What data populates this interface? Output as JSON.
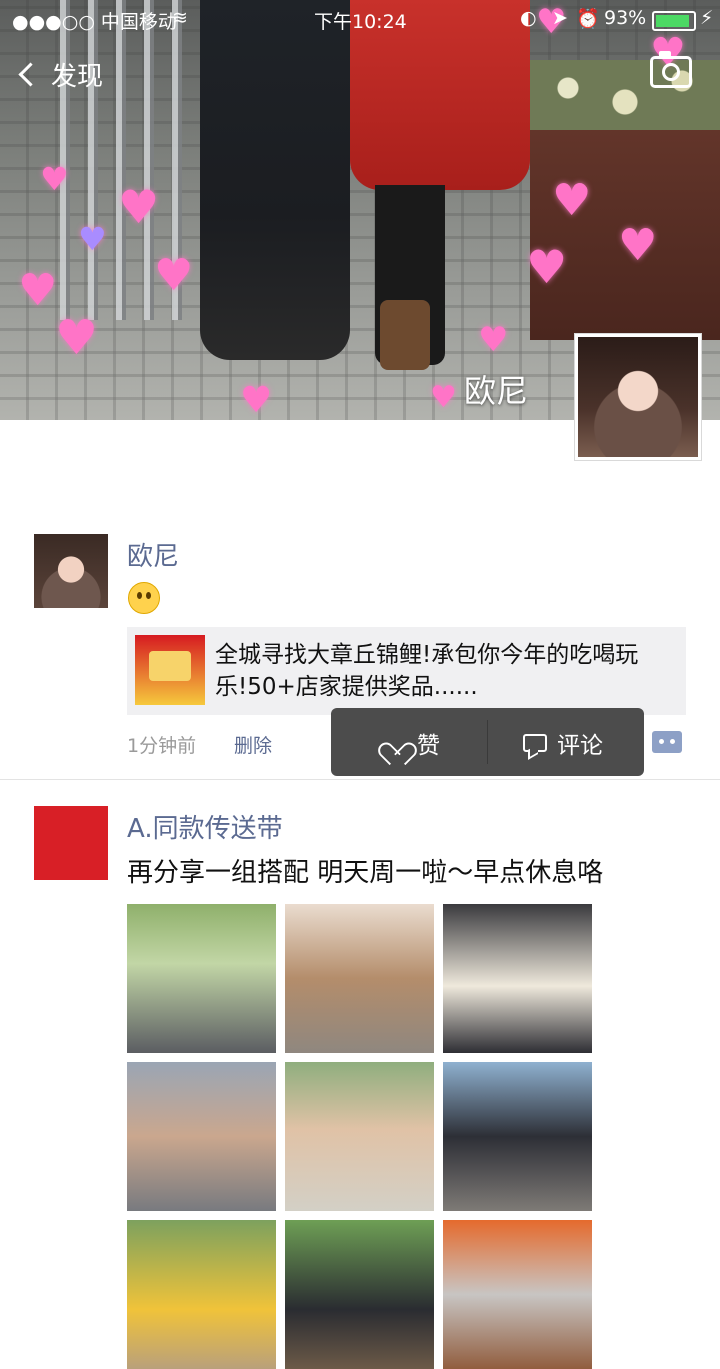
{
  "status_bar": {
    "carrier": "●●●○○ 中国移动",
    "time": "下午10:24",
    "battery": "93%",
    "battery_level": 0.93
  },
  "nav": {
    "back_label": "发现"
  },
  "cover": {
    "name": "欧尼"
  },
  "posts": [
    {
      "nickname": "欧尼",
      "link_title": "全城寻找大章丘锦鲤!承包你今年的吃喝玩乐!50+店家提供奖品......",
      "time": "1分钟前",
      "delete_label": "删除"
    },
    {
      "nickname": "A.同款传送带",
      "text": "再分享一组搭配 明天周一啦～早点休息咯"
    }
  ],
  "action_popup": {
    "like_label": "赞",
    "comment_label": "评论"
  },
  "colors": {
    "nickname": "#5b6a91",
    "popup_bg": "#4c4c4c",
    "battery": "#4cd964"
  }
}
